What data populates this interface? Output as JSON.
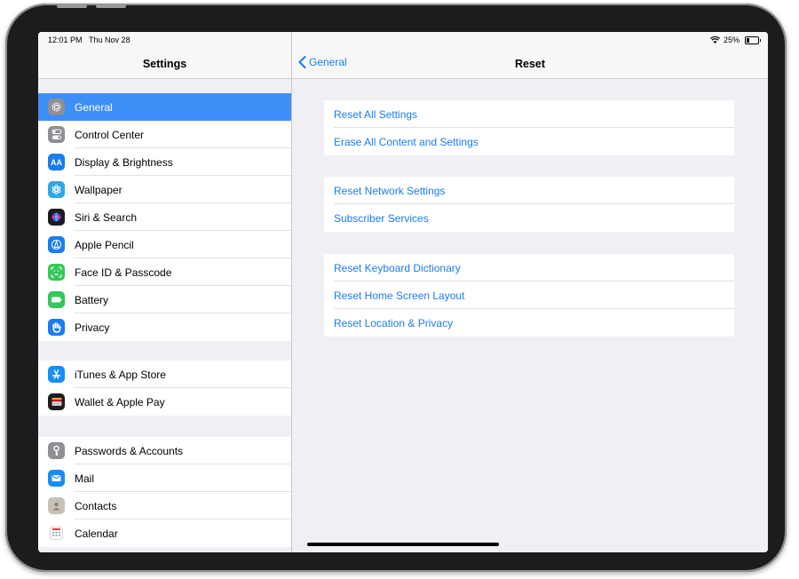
{
  "status": {
    "time": "12:01 PM",
    "date": "Thu Nov 28",
    "battery": "25%",
    "battery_level": 0.25
  },
  "sidebar": {
    "title": "Settings",
    "groups": [
      {
        "items": [
          {
            "label": "General",
            "icon": "gear-icon",
            "color": "#8e8e93",
            "selected": true
          },
          {
            "label": "Control Center",
            "icon": "toggles-icon",
            "color": "#8e8e93"
          },
          {
            "label": "Display & Brightness",
            "icon": "text-size-icon",
            "color": "#1a7cf0"
          },
          {
            "label": "Wallpaper",
            "icon": "flower-icon",
            "color": "#2fa8e8"
          },
          {
            "label": "Siri & Search",
            "icon": "siri-icon",
            "color": "#1c1c1e"
          },
          {
            "label": "Apple Pencil",
            "icon": "pencil-icon",
            "color": "#1a7cf0"
          },
          {
            "label": "Face ID & Passcode",
            "icon": "face-id-icon",
            "color": "#34c759"
          },
          {
            "label": "Battery",
            "icon": "battery-icon",
            "color": "#34c759"
          },
          {
            "label": "Privacy",
            "icon": "hand-icon",
            "color": "#1a7cf0"
          }
        ]
      },
      {
        "items": [
          {
            "label": "iTunes & App Store",
            "icon": "app-store-icon",
            "color": "#1a8cf6"
          },
          {
            "label": "Wallet & Apple Pay",
            "icon": "wallet-icon",
            "color": "#1c1c1e"
          }
        ]
      },
      {
        "items": [
          {
            "label": "Passwords & Accounts",
            "icon": "key-icon",
            "color": "#8e8e93"
          },
          {
            "label": "Mail",
            "icon": "mail-icon",
            "color": "#1a8cf6"
          },
          {
            "label": "Contacts",
            "icon": "contacts-icon",
            "color": "#c7c2b8"
          },
          {
            "label": "Calendar",
            "icon": "calendar-icon",
            "color": "#ffffff"
          }
        ]
      }
    ]
  },
  "detail": {
    "back_label": "General",
    "title": "Reset",
    "groups": [
      {
        "items": [
          "Reset All Settings",
          "Erase All Content and Settings"
        ]
      },
      {
        "items": [
          "Reset Network Settings",
          "Subscriber Services"
        ]
      },
      {
        "items": [
          "Reset Keyboard Dictionary",
          "Reset Home Screen Layout",
          "Reset Location & Privacy"
        ]
      }
    ]
  }
}
